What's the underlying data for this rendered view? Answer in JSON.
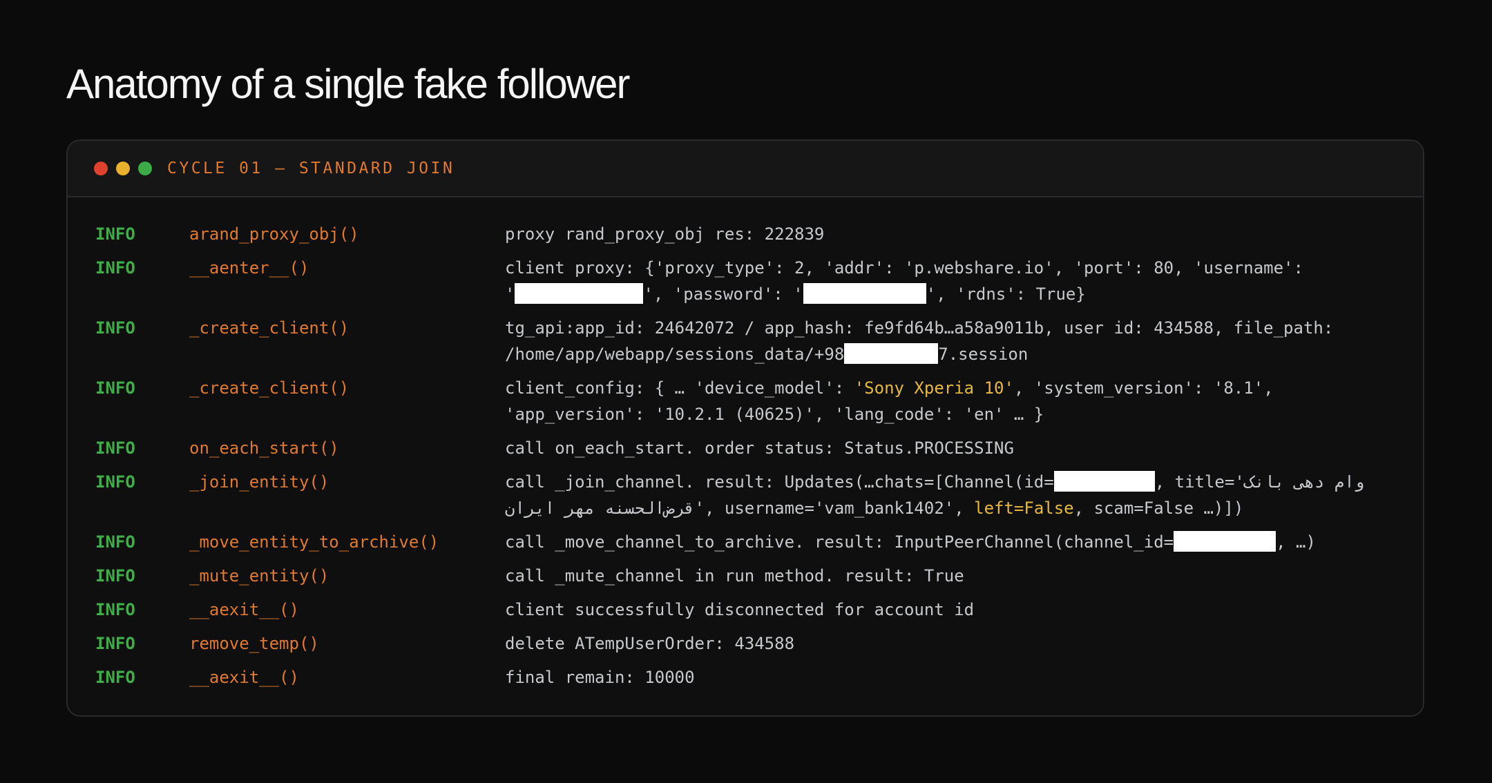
{
  "page": {
    "title": "Anatomy of a single fake follower"
  },
  "terminal": {
    "title": "CYCLE 01 — STANDARD JOIN",
    "dots": [
      {
        "name": "close",
        "color": "#e0402e"
      },
      {
        "name": "minimize",
        "color": "#e8b22c"
      },
      {
        "name": "maximize",
        "color": "#3cab47"
      }
    ]
  },
  "colors": {
    "background": "#0b0b0c",
    "level": "#3fae48",
    "function": "#e07a2e",
    "message": "#c7c9cc",
    "highlight": "#e6b93c",
    "redaction": "#ffffff"
  },
  "log": [
    {
      "level": "INFO",
      "fn": "arand_proxy_obj()",
      "msg": "proxy rand_proxy_obj res: 222839"
    },
    {
      "level": "INFO",
      "fn": "__aenter__()",
      "msg_a": "client proxy: {'proxy_type': 2, 'addr': 'p.webshare.io', 'port': 80, 'username':\n'",
      "msg_b": "', 'password': '",
      "msg_c": "', 'rdns': True}"
    },
    {
      "level": "INFO",
      "fn": "_create_client()",
      "msg_a": "tg_api:app_id: 24642072 / app_hash: fe9fd64b…a58a9011b, user id: 434588, file_path:\n/home/app/webapp/sessions_data/+98",
      "msg_b": "7.session"
    },
    {
      "level": "INFO",
      "fn": "_create_client()",
      "msg_a": "client_config: { … 'device_model': ",
      "msg_hl": "'Sony Xperia 10'",
      "msg_b": ", 'system_version': '8.1',\n'app_version': '10.2.1 (40625)', 'lang_code': 'en' … }"
    },
    {
      "level": "INFO",
      "fn": "on_each_start()",
      "msg": "call on_each_start. order status: Status.PROCESSING"
    },
    {
      "level": "INFO",
      "fn": "_join_entity()",
      "msg_a": "call _join_channel. result: Updates(…chats=[Channel(id=",
      "msg_b": ", title='",
      "msg_rtl": "وام دهی بانک قرض‌الحسنه مهر ایران",
      "msg_c": "', username='vam_bank1402', ",
      "msg_hl": "left=False",
      "msg_d": ", scam=False …)])"
    },
    {
      "level": "INFO",
      "fn": "_move_entity_to_archive()",
      "msg_a": "call _move_channel_to_archive. result: InputPeerChannel(channel_id=",
      "msg_b": ", …)"
    },
    {
      "level": "INFO",
      "fn": "_mute_entity()",
      "msg": "call _mute_channel in run method. result: True"
    },
    {
      "level": "INFO",
      "fn": "__aexit__()",
      "msg": "client successfully disconnected for account id"
    },
    {
      "level": "INFO",
      "fn": "remove_temp()",
      "msg": "delete ATempUserOrder: 434588"
    },
    {
      "level": "INFO",
      "fn": "__aexit__()",
      "msg": "final remain: 10000"
    }
  ]
}
